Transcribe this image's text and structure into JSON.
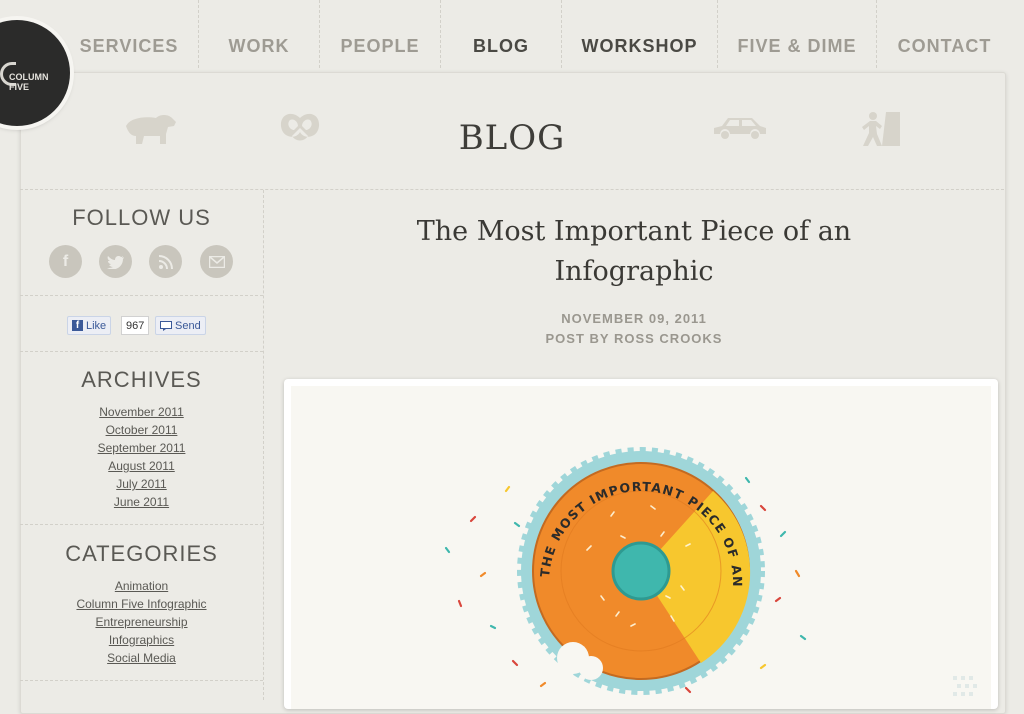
{
  "nav": {
    "items": [
      {
        "label": "SERVICES"
      },
      {
        "label": "WORK"
      },
      {
        "label": "PEOPLE"
      },
      {
        "label": "BLOG"
      },
      {
        "label": "WORKSHOP"
      },
      {
        "label": "FIVE & DIME"
      },
      {
        "label": "CONTACT"
      }
    ]
  },
  "logo": {
    "line1": "COLUMN",
    "line2": "FIVE"
  },
  "header": {
    "title": "BLOG",
    "icons": [
      "bear-icon",
      "pretzel-icon",
      "car-icon",
      "climber-icon"
    ]
  },
  "sidebar": {
    "follow_title": "FOLLOW US",
    "social": [
      {
        "glyph": "f",
        "icon": "facebook-icon"
      },
      {
        "glyph": "t",
        "icon": "twitter-icon"
      },
      {
        "glyph": "rss",
        "icon": "rss-icon"
      },
      {
        "glyph": "@",
        "icon": "email-icon"
      }
    ],
    "fb": {
      "like": "Like",
      "count": "967",
      "send": "Send"
    },
    "archives_title": "ARCHIVES",
    "archives": [
      "November 2011",
      "October 2011",
      "September 2011",
      "August 2011",
      "July 2011",
      "June 2011"
    ],
    "categories_title": "CATEGORIES",
    "categories": [
      "Animation",
      "Column Five Infographic",
      "Entrepreneurship",
      "Infographics",
      "Social Media"
    ]
  },
  "post": {
    "title_line1": "The Most Important Piece of an",
    "title_line2": "Infographic",
    "date": "NOVEMBER 09, 2011",
    "author": "POST BY ROSS CROOKS",
    "image_text": "THE MOST IMPORTANT PIECE OF AN INFOGRAPHIC"
  },
  "colors": {
    "background": "#ecebe6",
    "logo": "#2b2b2a",
    "donut_orange": "#f08a2a",
    "donut_yellow": "#f7c72e",
    "donut_teal": "#3fb7ad",
    "frame_blue": "#9fd6d9"
  }
}
